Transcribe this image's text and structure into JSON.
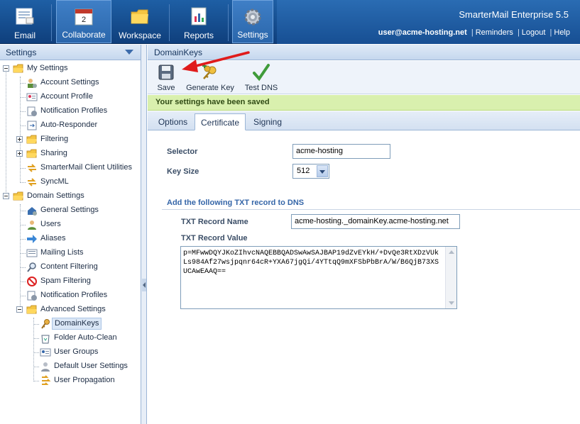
{
  "topnav": {
    "items": [
      {
        "label": "Email",
        "icon": "email-icon"
      },
      {
        "label": "Collaborate",
        "icon": "calendar-icon",
        "active": true,
        "badge": "2"
      },
      {
        "label": "Workspace",
        "icon": "folder-icon"
      },
      {
        "label": "Reports",
        "icon": "report-icon"
      },
      {
        "label": "Settings",
        "icon": "gear-icon",
        "active": true
      }
    ],
    "brand": "SmarterMail Enterprise 5.5",
    "user": "user@acme-hosting.net",
    "links": [
      "Reminders",
      "Logout",
      "Help"
    ]
  },
  "sidebar": {
    "title": "Settings",
    "tree": [
      {
        "label": "My Settings"
      },
      {
        "label": "Account Settings"
      },
      {
        "label": "Account Profile"
      },
      {
        "label": "Notification Profiles"
      },
      {
        "label": "Auto-Responder"
      },
      {
        "label": "Filtering"
      },
      {
        "label": "Sharing"
      },
      {
        "label": "SmarterMail Client Utilities"
      },
      {
        "label": "SyncML"
      },
      {
        "label": "Domain Settings"
      },
      {
        "label": "General Settings"
      },
      {
        "label": "Users"
      },
      {
        "label": "Aliases"
      },
      {
        "label": "Mailing Lists"
      },
      {
        "label": "Content Filtering"
      },
      {
        "label": "Spam Filtering"
      },
      {
        "label": "Notification Profiles"
      },
      {
        "label": "Advanced Settings"
      },
      {
        "label": "DomainKeys"
      },
      {
        "label": "Folder Auto-Clean"
      },
      {
        "label": "User Groups"
      },
      {
        "label": "Default User Settings"
      },
      {
        "label": "User Propagation"
      }
    ]
  },
  "main": {
    "title": "DomainKeys",
    "toolbar": [
      {
        "label": "Save",
        "icon": "save-icon"
      },
      {
        "label": "Generate Key",
        "icon": "keys-icon"
      },
      {
        "label": "Test DNS",
        "icon": "checkmark-icon"
      }
    ],
    "notice": "Your settings have been saved",
    "tabs": [
      "Options",
      "Certificate",
      "Signing"
    ],
    "active_tab": "Certificate",
    "form": {
      "selector_label": "Selector",
      "selector_value": "acme-hosting",
      "keysize_label": "Key Size",
      "keysize_value": "512",
      "section_title": "Add the following TXT record to DNS",
      "txt_name_label": "TXT Record Name",
      "txt_name_value": "acme-hosting._domainKey.acme-hosting.net",
      "txt_value_label": "TXT Record Value",
      "txt_value": "p=MFwwDQYJKoZIhvcNAQEBBQADSwAwSAJBAP19dZvEYkH/+DvQe3RtXDzVUkLs984Af27wsjpqnr64cR+YXA67jgQi/4YTtqQ9mXFSbPbBrA/W/B6QjB73XSUCAwEAAQ=="
    }
  },
  "colors": {
    "nav_bg": "#1e5fa5",
    "notice_bg": "#d9f0ae",
    "annotation_arrow": "#e01b1b"
  }
}
